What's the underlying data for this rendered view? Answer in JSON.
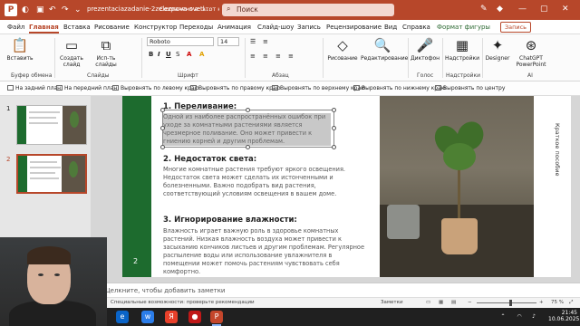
{
  "titlebar": {
    "file_name": "prezentaciazadanie-2zeleznova-svetl...",
    "save_status": "Сохранено в: этот компьютер",
    "search_placeholder": "Поиск",
    "accent": "#b7472a"
  },
  "menu": {
    "tabs": [
      "Файл",
      "Главная",
      "Вставка",
      "Рисование",
      "Конструктор",
      "Переходы",
      "Анимация",
      "Слайд-шоу",
      "Запись",
      "Рецензирование",
      "Вид",
      "Справка",
      "Формат фигуры"
    ],
    "share_label": "Запись"
  },
  "ribbon": {
    "paste_label": "Вставить",
    "clipboard_group": "Буфер обмена",
    "new_slide_label": "Создать слайд",
    "reuse_label": "Исп-ть слайды",
    "slides_group": "Слайды",
    "font_name": "Roboto",
    "font_size": "14",
    "font_group": "Шрифт",
    "paragraph_group": "Абзац",
    "drawing_label": "Рисование",
    "editing_label": "Редактирование",
    "dictate_label": "Диктофон",
    "voice_group": "Голос",
    "addins_label": "Надстройки",
    "addins_group": "Надстройки",
    "designer_label": "Designer",
    "gpt_label": "ChatGPT PowerPoint",
    "ai_group": "AI"
  },
  "context_toolbar": {
    "items": [
      "На задний план",
      "На передний план",
      "Выровнять по левому краю",
      "Выровнять по правому краю",
      "Выровнять по верхнему краю",
      "Выровнять по нижнему краю",
      "Выровнять по центру"
    ]
  },
  "thumbnails": [
    {
      "number": "1"
    },
    {
      "number": "2"
    }
  ],
  "slide": {
    "number": "2",
    "heading1": "1. Переливание:",
    "para1": "Одной из наиболее распространённых ошибок при уходе за комнатными растениями является чрезмерное поливание. Оно может привести к гниению корней и другим проблемам.",
    "heading2": "2. Недостаток света:",
    "para2": "Многие комнатные растения требуют яркого освещения. Недостаток света может сделать их истонченными  и болезненными. Важно подобрать вид растения, соответствующий условиям освещения в вашем доме.",
    "heading3": "3. Игнорирование влажности:",
    "para3": "Влажность играет важную роль в здоровье комнатных растений. Низкая влажность воздуха может привести к засыханию кончиков листьев и другим проблемам. Регулярное распыление воды или использование увлажнителя в помещении может помочь растениям чувствовать себя комфортно.",
    "vertical_text": "Краткое пособие"
  },
  "notes": {
    "placeholder": "Щелкните, чтобы добавить заметки"
  },
  "statusbar": {
    "accessibility": "Специальные возможности: проверьте рекомендации",
    "notes_label": "Заметки",
    "zoom": "75 %"
  },
  "taskbar": {
    "time": "21:45",
    "date": "10.06.2025"
  }
}
